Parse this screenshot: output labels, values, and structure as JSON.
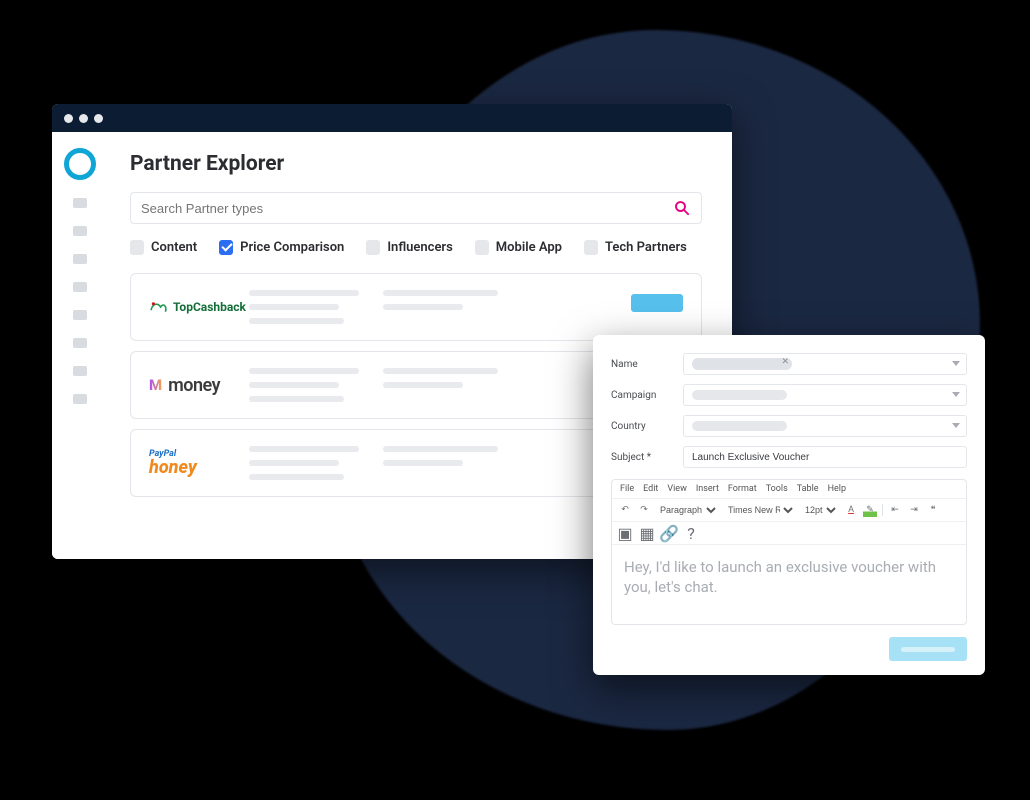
{
  "main": {
    "title": "Partner Explorer",
    "search": {
      "placeholder": "Search Partner types"
    },
    "filters": [
      {
        "label": "Content",
        "checked": false
      },
      {
        "label": "Price Comparison",
        "checked": true
      },
      {
        "label": "Influencers",
        "checked": false
      },
      {
        "label": "Mobile App",
        "checked": false
      },
      {
        "label": "Tech Partners",
        "checked": false
      }
    ],
    "partners": [
      {
        "name": "TopCashback"
      },
      {
        "name": "money"
      },
      {
        "name": "PayPal Honey"
      }
    ]
  },
  "compose": {
    "labels": {
      "name": "Name",
      "campaign": "Campaign",
      "country": "Country",
      "subject": "Subject *"
    },
    "subject_value": "Launch Exclusive Voucher",
    "menu": [
      "File",
      "Edit",
      "View",
      "Insert",
      "Format",
      "Tools",
      "Table",
      "Help"
    ],
    "toolbar": {
      "para": "Paragraph",
      "font": "Times New R…",
      "size": "12pt"
    },
    "body": "Hey, I'd like to launch an exclusive voucher with you, let's chat."
  }
}
